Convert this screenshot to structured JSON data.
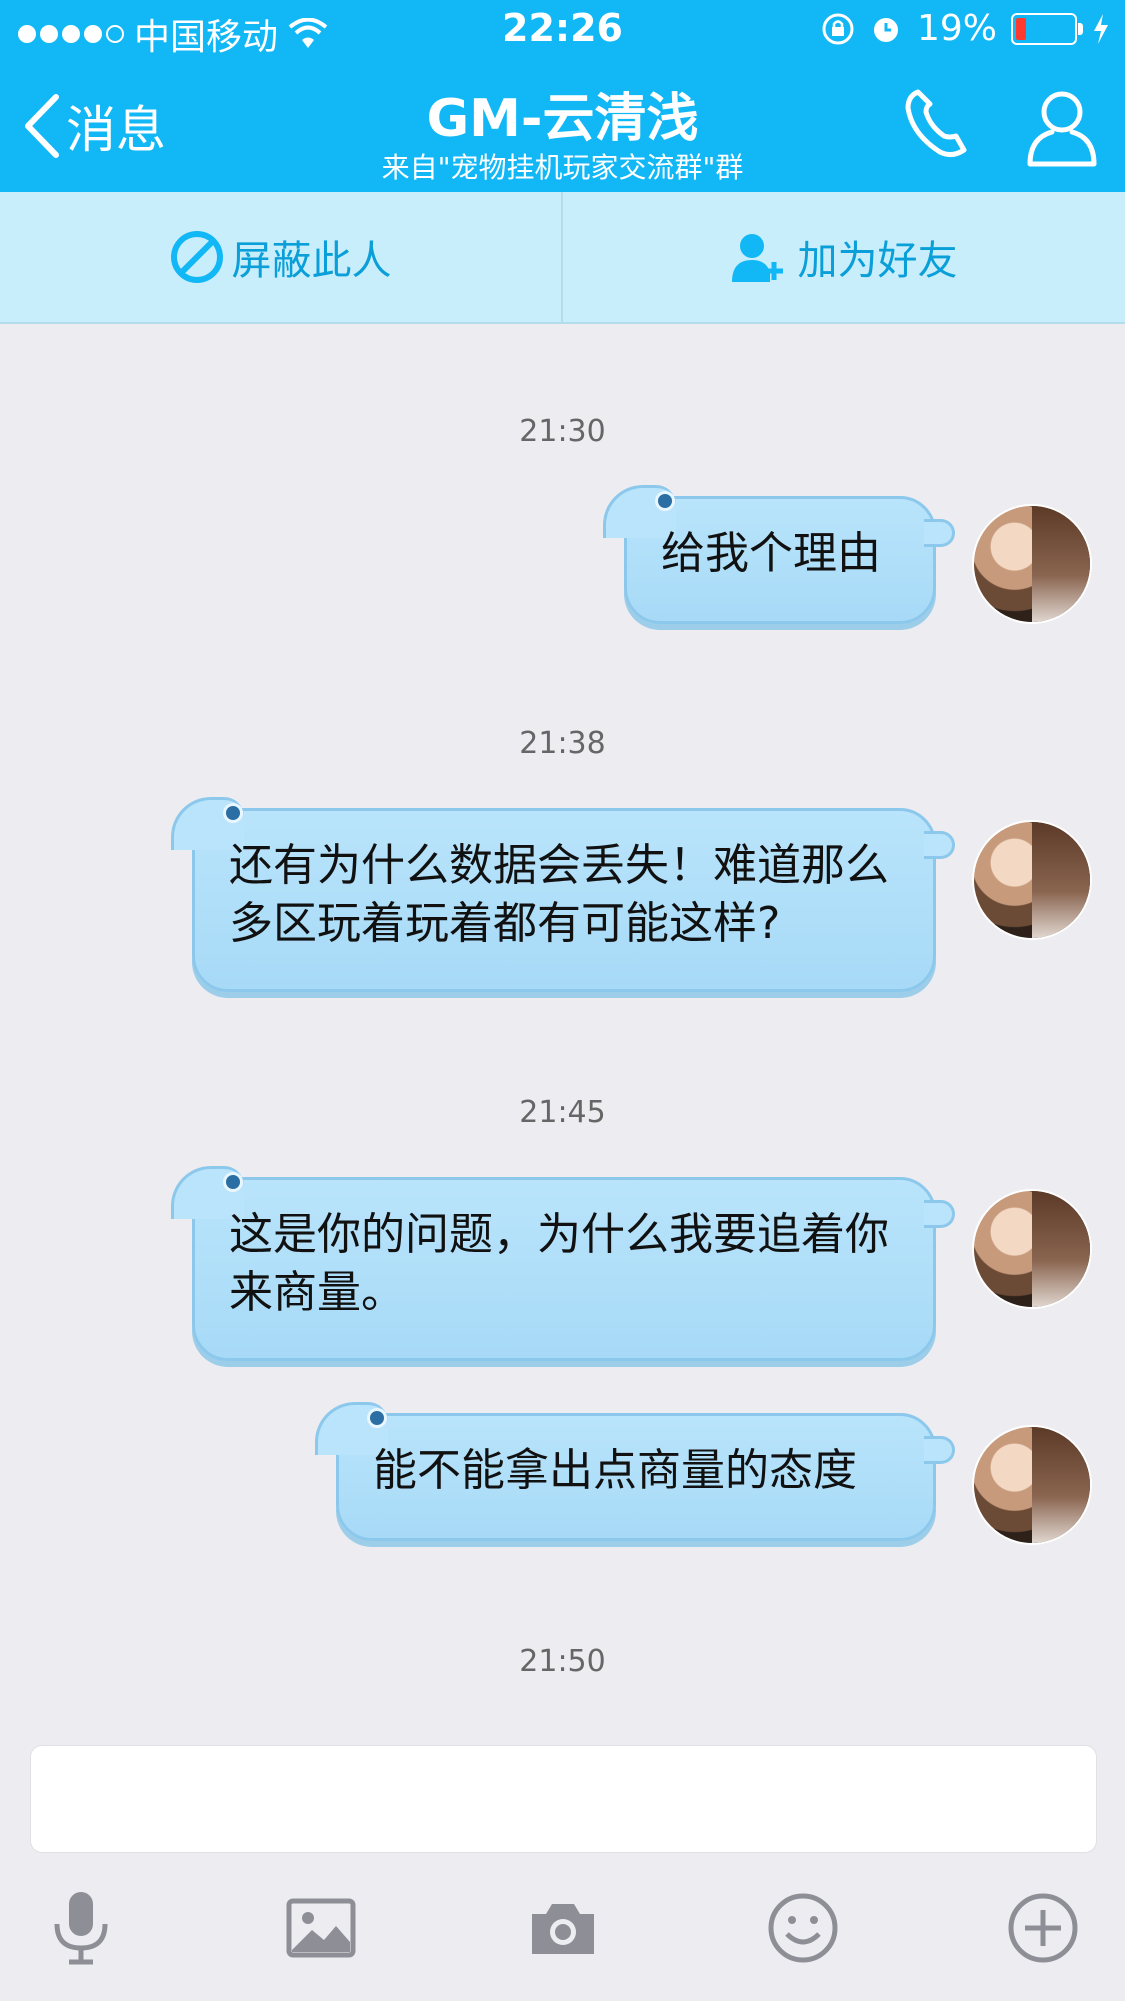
{
  "status_bar": {
    "carrier": "中国移动",
    "time": "22:26",
    "battery": "19%"
  },
  "nav": {
    "back_label": "消息",
    "title": "GM-云清浅",
    "subtitle": "来自\"宠物挂机玩家交流群\"群"
  },
  "actions": {
    "block_label": "屏蔽此人",
    "add_friend_label": "加为好友"
  },
  "messages": [
    {
      "time": "21:30",
      "text": "给我个理由"
    },
    {
      "time": "21:38",
      "text": "还有为什么数据会丢失！难道那么多区玩着玩着都有可能这样?"
    },
    {
      "time": "21:45",
      "text": "这是你的问题，为什么我要追着你来商量。"
    },
    {
      "text": "能不能拿出点商量的态度"
    },
    {
      "time": "21:50"
    }
  ],
  "colors": {
    "header": "#12b7f5",
    "action_bar": "#c8eefc",
    "bubble": "#a9dbf8",
    "background": "#ececf1"
  },
  "toolbar_icons": [
    "microphone-icon",
    "image-icon",
    "camera-icon",
    "emoji-icon",
    "plus-icon"
  ]
}
